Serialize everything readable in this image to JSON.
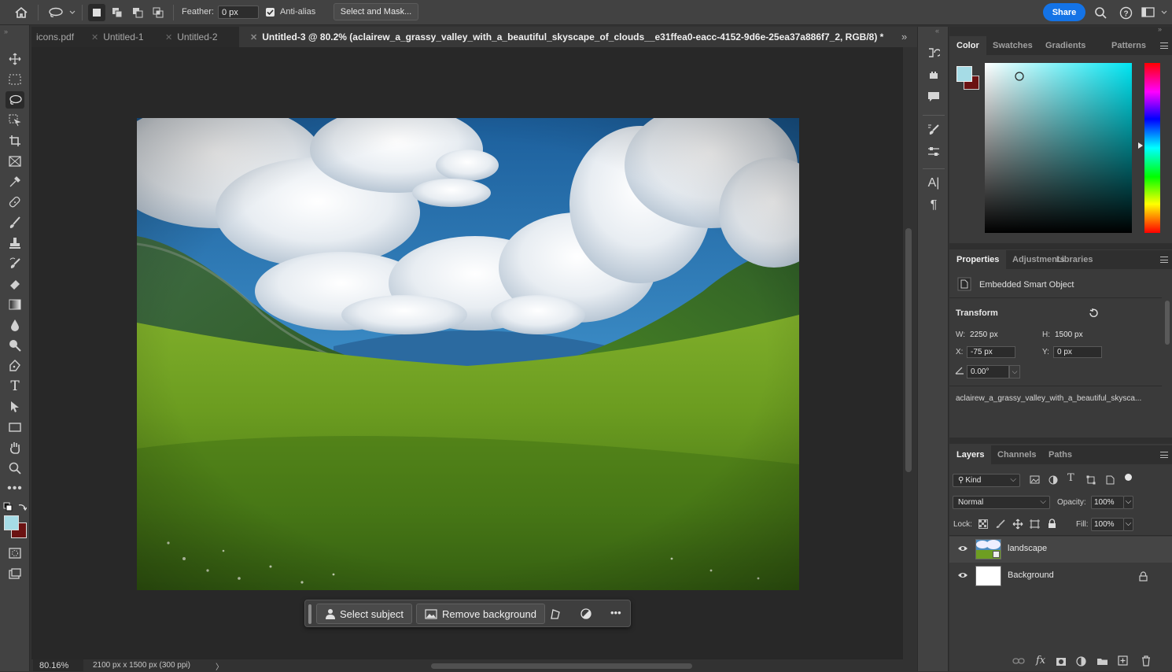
{
  "options_bar": {
    "feather_label": "Feather:",
    "feather_value": "0 px",
    "antialias_label": "Anti-alias",
    "select_mask_label": "Select and Mask...",
    "share_label": "Share"
  },
  "tabs": [
    {
      "label": "icons.pdf",
      "active": false
    },
    {
      "label": "Untitled-1",
      "active": false
    },
    {
      "label": "Untitled-2",
      "active": false
    },
    {
      "label": "Untitled-3 @ 80.2% (aclairew_a_grassy_valley_with_a_beautiful_skyscape_of_clouds__e31ffea0-eacc-4152-9d6e-25ea37a886f7_2, RGB/8) *",
      "active": true
    }
  ],
  "taskbar": {
    "select_subject_label": "Select subject",
    "remove_background_label": "Remove background"
  },
  "status": {
    "zoom": "80.16%",
    "doc_info": "2100 px x 1500 px (300 ppi)"
  },
  "color_panel": {
    "tabs": [
      "Color",
      "Swatches",
      "Gradients",
      "Patterns"
    ],
    "foreground": "#a6dce6",
    "background": "#6b1212"
  },
  "properties_panel": {
    "tabs": [
      "Properties",
      "Adjustments",
      "Libraries"
    ],
    "type_label": "Embedded Smart Object",
    "transform_label": "Transform",
    "w_label": "W:",
    "w_value": "2250 px",
    "h_label": "H:",
    "h_value": "1500 px",
    "x_label": "X:",
    "x_value": "-75 px",
    "y_label": "Y:",
    "y_value": "0 px",
    "angle_value": "0.00°",
    "source_file": "aclairew_a_grassy_valley_with_a_beautiful_skysca..."
  },
  "layers_panel": {
    "tabs": [
      "Layers",
      "Channels",
      "Paths"
    ],
    "filter_kind": "Kind",
    "blend_mode": "Normal",
    "opacity_label": "Opacity:",
    "opacity_value": "100%",
    "lock_label": "Lock:",
    "fill_label": "Fill:",
    "fill_value": "100%",
    "layers": [
      {
        "name": "landscape"
      },
      {
        "name": "Background"
      }
    ]
  }
}
